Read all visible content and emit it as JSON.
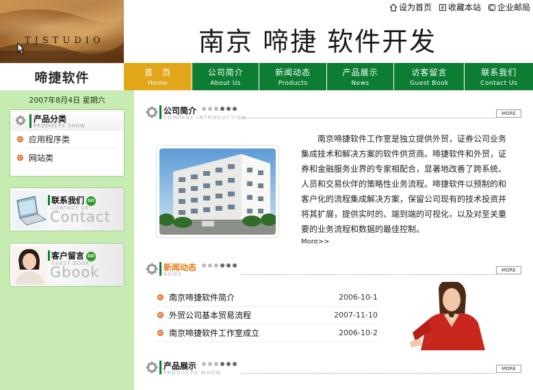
{
  "header": {
    "studio_text": "TJSTUDIO",
    "site_title": "南京  啼捷  软件开发",
    "brand": "啼捷软件",
    "top_links": [
      {
        "label": "设为首页",
        "icon": "home-icon"
      },
      {
        "label": "收藏本站",
        "icon": "bookmark-icon"
      },
      {
        "label": "企业邮局",
        "icon": "mail-icon"
      }
    ]
  },
  "nav": [
    {
      "cn": "首　页",
      "en": "Home",
      "active": true
    },
    {
      "cn": "公司简介",
      "en": "About Us"
    },
    {
      "cn": "新闻动态",
      "en": "Products"
    },
    {
      "cn": "产品展示",
      "en": "News"
    },
    {
      "cn": "访客留言",
      "en": "Guest Book"
    },
    {
      "cn": "联系我们",
      "en": "Contact Us"
    }
  ],
  "sidebar": {
    "date": "2007年8月4日  星期六",
    "categories": {
      "title": "产品分类",
      "subtitle": "PRODUCTS SHOW",
      "items": [
        "应用程序类",
        "网站类"
      ]
    },
    "contact": {
      "title": "联系我们",
      "badge": "GO",
      "en": "CONTACT US",
      "big": "Contact"
    },
    "gbook": {
      "title": "客户留言",
      "badge": "GO",
      "en": "GUEST BOOK",
      "big": "Gbook"
    }
  },
  "main": {
    "intro": {
      "title": "公司简介",
      "subtitle": "COMPANY INTRODUCTION",
      "more": "MORE",
      "text": "南京啼捷软件工作室是独立提供外贸，证券公司业务集成技术和解决方案的软件供货商。啼捷软件和外贸，证券和金融服务业界的专家相配合，显著地改善了跨系统、人员和交易伙伴的策略性业务流程。啼捷软件以预制的和客户化的流程集成解决方案，保留公司现有的技术投资并将其扩展，提供实时的、端到端的可视化，以及对至关重要的业务流程和数据的最佳控制。",
      "more_link": "More>>"
    },
    "news": {
      "title": "新闻动态",
      "subtitle": "NEWS",
      "more": "MORE",
      "items": [
        {
          "title": "南京啼捷软件简介",
          "date": "2006-10-1"
        },
        {
          "title": "外贸公司基本贸易流程",
          "date": "2007-11-10"
        },
        {
          "title": "南京啼捷软件工作室成立",
          "date": "2006-10-2"
        }
      ]
    },
    "products": {
      "title": "产品展示",
      "subtitle": "PRODUCTS WHOW",
      "more": "MORE"
    }
  },
  "colors": {
    "nav_green": "#0c7d33",
    "nav_active": "#e2a61b",
    "sidebar_bg": "#c6ecb2",
    "bullet_orange": "#e35d1a"
  }
}
